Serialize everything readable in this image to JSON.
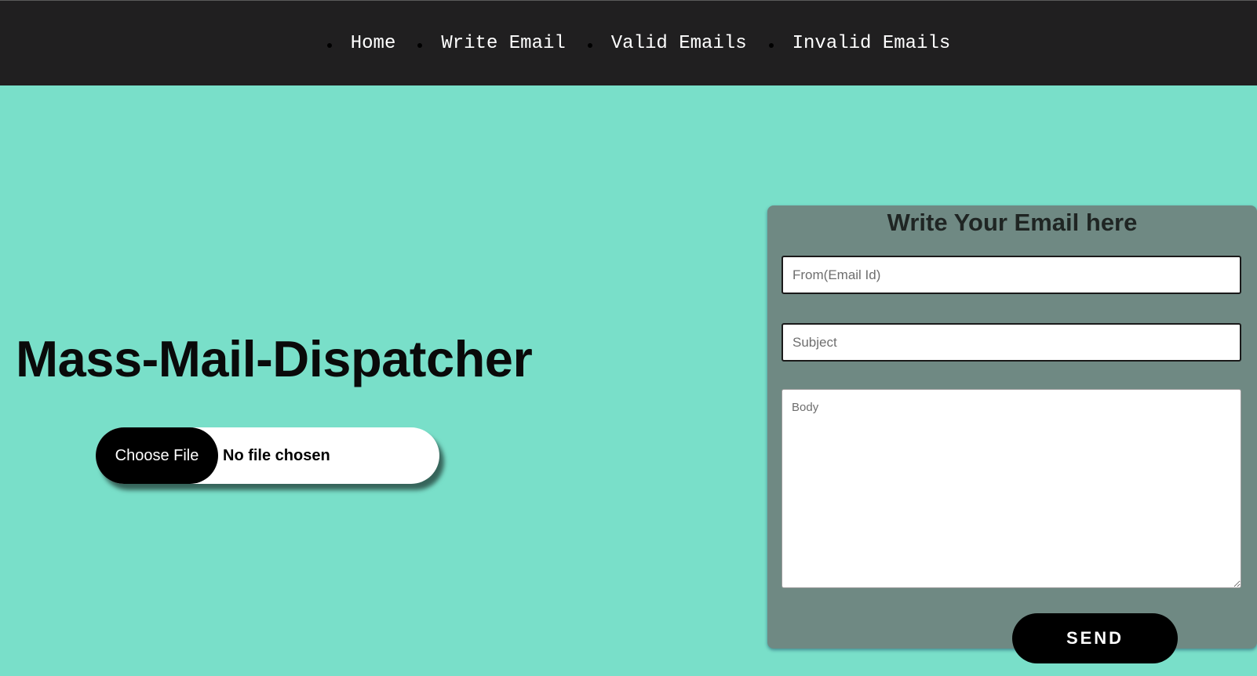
{
  "nav": {
    "items": [
      {
        "label": "Home"
      },
      {
        "label": "Write Email"
      },
      {
        "label": "Valid Emails"
      },
      {
        "label": "Invalid Emails"
      }
    ]
  },
  "hero": {
    "title": "Mass-Mail-Dispatcher"
  },
  "file_picker": {
    "button_label": "Choose File",
    "status": "No file chosen"
  },
  "form": {
    "heading": "Write Your Email here",
    "from": {
      "placeholder": "From(Email Id)",
      "value": ""
    },
    "subject": {
      "placeholder": "Subject",
      "value": ""
    },
    "body": {
      "placeholder": "Body",
      "value": ""
    },
    "send_label": "SEND"
  },
  "colors": {
    "page_background": "#79dfc9",
    "navbar_background": "#201f20",
    "form_card_background": "#6f8983",
    "button_background": "#000000"
  }
}
